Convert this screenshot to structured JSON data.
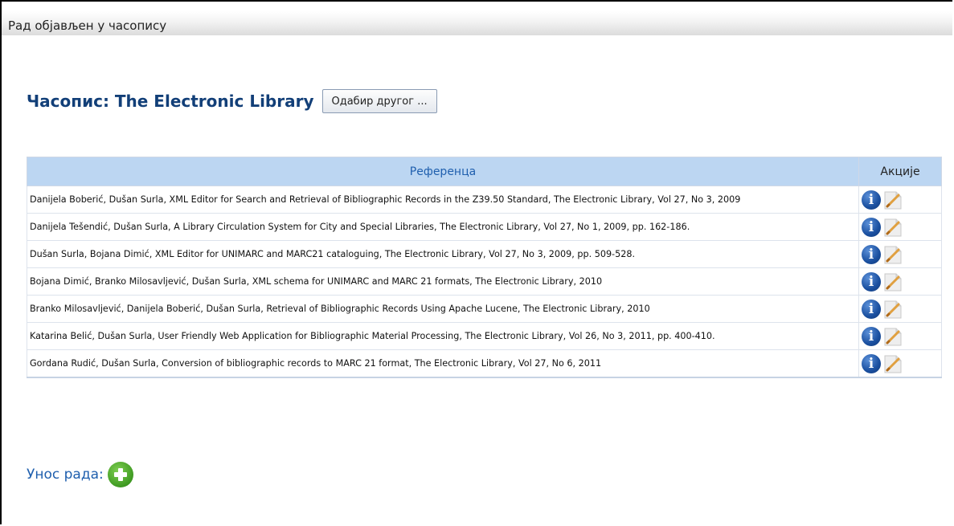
{
  "section_title": "Рад објављен у часопису",
  "journal": {
    "label": "Часопис: The Electronic Library",
    "choose_button": "Одабир другог ..."
  },
  "table": {
    "headers": [
      "Референца",
      "Акције"
    ],
    "rows": [
      "Danijela Boberić, Dušan Surla, XML Editor for Search and Retrieval of Bibliographic Records in the Z39.50 Standard, The Electronic Library, Vol 27, No 3, 2009",
      "Danijela Tešendić, Dušan Surla, A Library Circulation System for City and Special Libraries, The Electronic Library, Vol 27, No 1, 2009, pp. 162-186.",
      "Dušan Surla, Bojana Dimić, XML Editor for UNIMARC and MARC21 cataloguing, The Electronic Library, Vol 27, No 3, 2009, pp. 509-528.",
      "Bojana Dimić, Branko Milosavljević, Dušan Surla, XML schema for UNIMARC and MARC 21 formats, The Electronic Library, 2010",
      "Branko Milosavljević, Danijela Boberić, Dušan Surla, Retrieval of Bibliographic Records Using Apache Lucene, The Electronic Library, 2010",
      "Katarina Belić, Dušan Surla, User Friendly Web Application for Bibliographic Material Processing, The Electronic Library, Vol 26, No 3, 2011, pp. 400-410.",
      "Gordana Rudić, Dušan Surla, Conversion of bibliographic records to MARC 21 format, The Electronic Library, Vol 27, No 6, 2011"
    ],
    "row_action_icons": [
      "info-icon",
      "edit-icon"
    ]
  },
  "add_entry": {
    "label": "Унос рада:",
    "icon": "add-icon"
  },
  "colors": {
    "header_bg": "#bcd6f2",
    "title_blue": "#123f78",
    "link_blue": "#1f5fae",
    "add_green": "#3f9a22"
  }
}
